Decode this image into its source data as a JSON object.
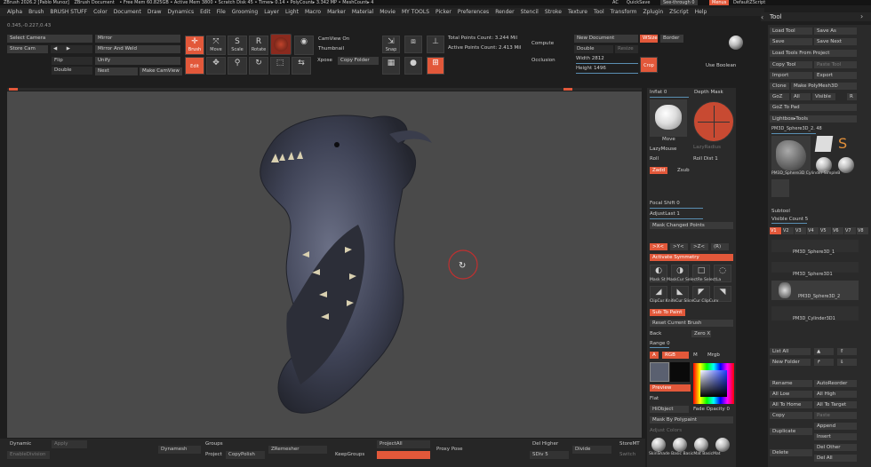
{
  "titlebar": {
    "app": "ZBrush 2026.2 [Pablo Munoz]",
    "doc": "ZBrush Document",
    "stats": "• Free Mem 60.825GB • Active Mem 3800 • Scratch Disk 45 • Timer▸ 0.14 • PolyCount▸ 3.342 MP • MeshCount▸ 4",
    "ai": "AC",
    "quicksave": "QuickSave",
    "seethrough": "See-through  0",
    "menus": "Menus",
    "script": "DefaultZScript"
  },
  "menubar": [
    "Alpha",
    "Brush",
    "BRUSH STUFF",
    "Color",
    "Document",
    "Draw",
    "Dynamics",
    "Edit",
    "File",
    "Grooming",
    "Layer",
    "Light",
    "Macro",
    "Marker",
    "Material",
    "Movie",
    "MY TOOLS",
    "Picker",
    "Preferences",
    "Render",
    "Stencil",
    "Stroke",
    "Texture",
    "Tool",
    "Transform",
    "Zplugin",
    "ZScript",
    "Help"
  ],
  "coords": "0.345,-0.227,0.43",
  "shelf": {
    "select_camera": "Select Camera",
    "store_cam": "Store Cam",
    "flip": "Flip",
    "double": "Double",
    "mirror": "Mirror",
    "mirror_weld": "Mirror And Weld",
    "unify": "Unify",
    "next": "Next",
    "make_camview": "Make CamView",
    "camview_on": "CamView On",
    "thumbnail": "Thumbnail",
    "copy_folder": "Copy Folder",
    "snap": "Snap",
    "total_points": "Total Points Count: 3.244 Mil",
    "active_points": "Active Points Count: 2.413 Mil",
    "compute": "Compute",
    "occlusion": "Occlusion",
    "new_document": "New Document",
    "double2": "Double",
    "resize": "Resize",
    "wsize": "WSize",
    "border": "Border",
    "width_label": "Width",
    "width_val": "2812",
    "height_label": "Height",
    "height_val": "1496",
    "crop": "Crop",
    "use_boolean": "Use Boolean",
    "icons": [
      {
        "label": "Brush"
      },
      {
        "label": "Move"
      },
      {
        "label": "Scale"
      },
      {
        "label": "Rotate"
      },
      {
        "label": "Edit"
      },
      {
        "label": "Scroll"
      },
      {
        "label": "Zoom"
      },
      {
        "label": "Rotate"
      },
      {
        "label": "Frame"
      },
      {
        "label": "Lsym"
      },
      {
        "label": "Persp"
      },
      {
        "label": "Floor"
      },
      {
        "label": "Xyz"
      },
      {
        "label": "Solo"
      },
      {
        "label": "Polyf"
      },
      {
        "label": "Transp"
      }
    ]
  },
  "right": {
    "tool_title": "Tool",
    "load_tool": "Load Tool",
    "save_as": "Save As",
    "save": "Save",
    "save_next": "Save Next",
    "load_tools_project": "Load Tools From Project",
    "copy_tool": "Copy Tool",
    "paste_tool": "Paste Tool",
    "import": "Import",
    "export": "Export",
    "clone": "Clone",
    "make_polymesh": "Make PolyMesh3D",
    "goz": "GoZ",
    "all": "All",
    "visible": "Visible",
    "r": "R",
    "goz_to_pad": "GoZ To Pad",
    "lightbox_tools": "Lightbox▸Tools",
    "current_tool": "PM3D_Sphere3D_2. 48",
    "thumbs": [
      "PM3D_Sphere3D",
      "PM3D_Sphere3D",
      "Cylinder",
      "SimpleB",
      "PM3D_1"
    ],
    "subtool": "Subtool",
    "visible_count": "Visible Count 5",
    "v_tabs": [
      "V1",
      "V2",
      "V3",
      "V4",
      "V5",
      "V6",
      "V7",
      "V8"
    ],
    "subtools": [
      "PM3D_Sphere3D_1",
      "PM3D_Sphere3D1",
      "PM3D_Sphere3D_2",
      "PM3D_Cylinder3D1"
    ],
    "list_all": "List All",
    "new_folder": "New Folder",
    "rename": "Rename",
    "autoreorder": "AutoReorder",
    "all_low": "All Low",
    "all_high": "All High",
    "all_to_home": "All To Home",
    "all_to_target": "All To Target",
    "copy": "Copy",
    "paste": "Paste",
    "duplicate": "Duplicate",
    "append": "Append",
    "insert": "Insert",
    "delete": "Delete",
    "del_other": "Del Other",
    "del_all": "Del All"
  },
  "mid": {
    "inflate": "Inflat 0",
    "depth_mask": "Depth Mask",
    "move": "Move",
    "lazy_mouse": "LazyMouse",
    "lazy_radius": "LazyRadius",
    "roll": "Roll",
    "roll_dist": "Roll Dist 1",
    "zadd": "Zadd",
    "zsub": "Zsub",
    "rgb_intensity": "Mrgb",
    "focal_shift": "Focal Shift 0",
    "adjust_last": "AdjustLast 1",
    "mask_changed": "Mask Changed Points",
    "x": ">X<",
    "y": ">Y<",
    "z": ">Z<",
    "r": "(R)",
    "activate_symmetry": "Activate Symmetry",
    "brush_icons": [
      "Mask St",
      "MaskCur",
      "SelectRe",
      "SelectLa",
      "ClipCur",
      "KnifeCur",
      "SliceCur",
      "ClipCurv"
    ],
    "sub_to_paint": "Sub To Paint",
    "reset_brush": "Reset Current Brush",
    "back": "Back",
    "zero_x": "Zero X",
    "range": "Range 0",
    "a": "A",
    "rgb": "RGB",
    "m": "M",
    "mrgb": "Mrgb",
    "preview": "Preview",
    "flat": "Flat",
    "hi_object": "HiObject",
    "fade_opacity": "Fade Opacity 0",
    "mask_polypaint": "Mask By Polypaint",
    "adjust_colors": "Adjust Colors",
    "materials": [
      "SkinShade",
      "Basic",
      "BasicMat",
      "BasicMat"
    ]
  },
  "bottom": {
    "dynamic": "Dynamic",
    "apply": "Apply",
    "dynamesh": "Dynamesh",
    "groups": "Groups",
    "project": "Project",
    "zremesher": "ZRemesher",
    "keepgroups": "KeepGroups",
    "project_all": "ProjectAll",
    "proxy_pose": "Proxy Pose",
    "del_higher": "Del Higher",
    "sdiv": "SDiv 5",
    "divide": "Divide",
    "store_mt": "StoreMT",
    "switch": "Switch",
    "copy_poly": "CopyPolish",
    "enzdivision": "EnableDivision"
  },
  "colors": {
    "accent": "#e2583a",
    "slider": "#5a8fb3",
    "panel": "#2a2a2a",
    "canvas": "#4a4a4a"
  }
}
